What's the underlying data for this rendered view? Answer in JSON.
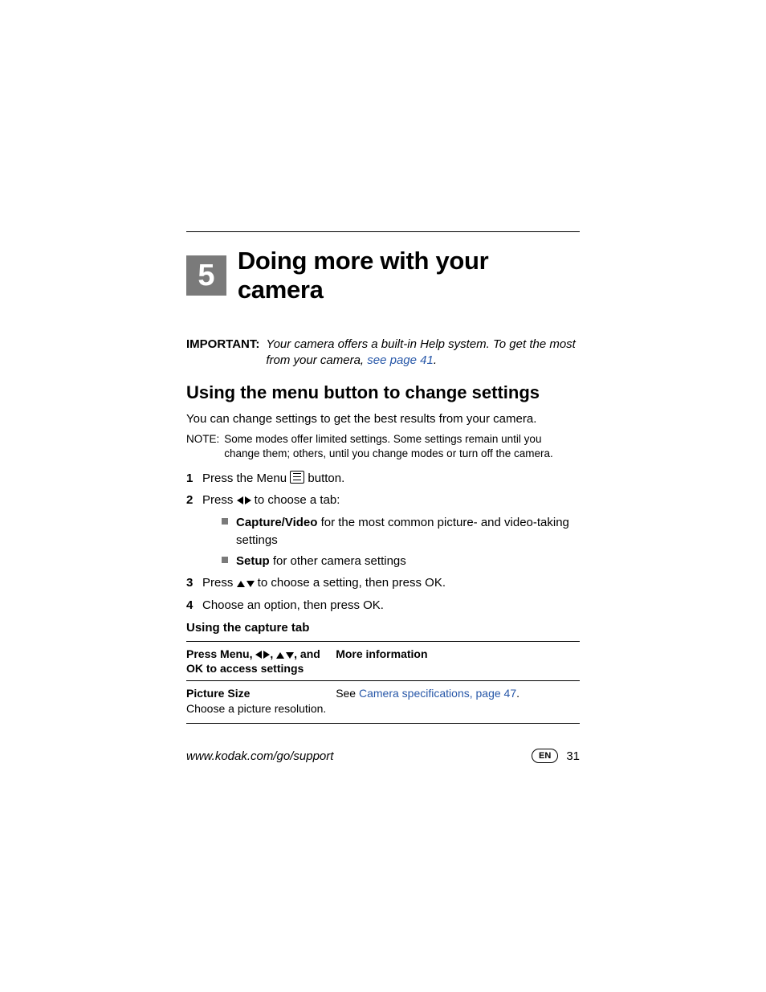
{
  "chapter": {
    "number": "5",
    "title": "Doing more with your camera"
  },
  "important": {
    "label": "IMPORTANT:",
    "text_before_link": "Your camera offers a built-in Help system. To get the most from your camera, ",
    "link_text": "see page 41",
    "text_after_link": "."
  },
  "section": {
    "heading": "Using the menu button to change settings",
    "intro": "You can change settings to get the best results from your camera.",
    "note_label": "NOTE:",
    "note_text": "Some modes offer limited settings. Some settings remain until you change them; others, until you change modes or turn off the camera.",
    "steps": {
      "s1_a": "Press the Menu ",
      "s1_b": " button.",
      "s2_a": "Press ",
      "s2_b": " to choose a tab:",
      "s2_bullets": {
        "b1_bold": "Capture/Video",
        "b1_rest": " for the most common picture- and video-taking settings",
        "b2_bold": "Setup",
        "b2_rest": " for other camera settings"
      },
      "s3_a": "Press ",
      "s3_b": " to choose a setting, then press OK.",
      "s4": "Choose an option, then press OK."
    },
    "capture_tab_heading": "Using the capture tab",
    "table": {
      "col1_header_a": "Press Menu, ",
      "col1_header_b": ", ",
      "col1_header_c": ", and OK to access settings",
      "col2_header": "More information",
      "row1": {
        "title": "Picture Size",
        "desc": "Choose a picture resolution.",
        "see": "See ",
        "link": "Camera specifications, page 47",
        "after": "."
      }
    }
  },
  "footer": {
    "url": "www.kodak.com/go/support",
    "lang": "EN",
    "page": "31"
  }
}
